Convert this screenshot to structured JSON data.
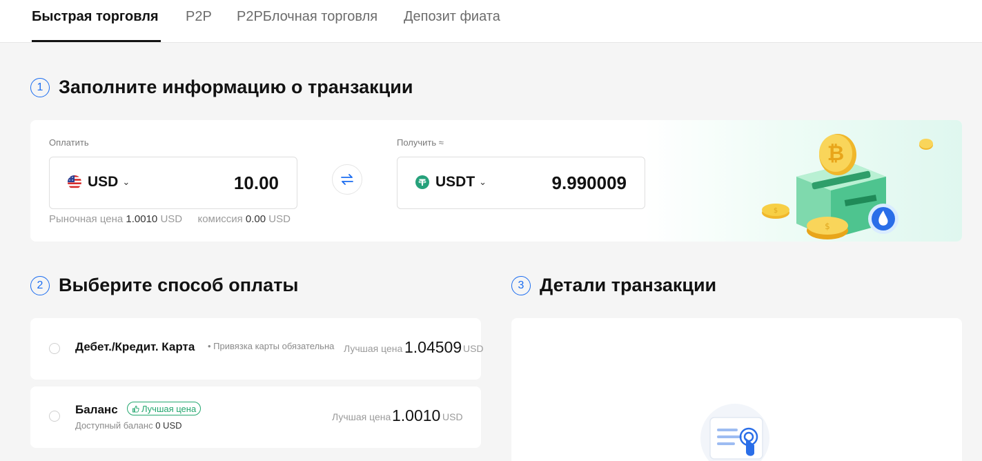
{
  "tabs": [
    "Быстрая торговля",
    "P2P",
    "P2PБлочная торговля",
    "Депозит фиата"
  ],
  "step1": {
    "num": "1",
    "title": "Заполните информацию о транзакции"
  },
  "pay": {
    "label": "Оплатить",
    "currency": "USD",
    "amount": "10.00",
    "flag_icon": "us-flag-icon"
  },
  "receive": {
    "label": "Получить ≈",
    "currency": "USDT",
    "amount": "9.990009",
    "token_icon": "tether-icon"
  },
  "rate": {
    "market_label": "Рыночная цена",
    "market_value": "1.0010",
    "market_unit": "USD",
    "fee_label": "комиссия",
    "fee_value": "0.00",
    "fee_unit": "USD"
  },
  "step2": {
    "num": "2",
    "title": "Выберите способ оплаты"
  },
  "step3": {
    "num": "3",
    "title": "Детали транзакции"
  },
  "methods": [
    {
      "name": "Дебет./Кредит. Карта",
      "note": "Привязка карты обязательна",
      "price_label": "Лучшая цена",
      "price": "1.04509",
      "unit": "USD"
    },
    {
      "name": "Баланс",
      "badge": "Лучшая цена",
      "available_label": "Доступный баланс",
      "available_value": "0 USD",
      "price_label": "Лучшая цена",
      "price": "1.0010",
      "unit": "USD"
    }
  ],
  "colors": {
    "accent": "#1a6cf0",
    "green": "#22a66d",
    "tether": "#26a17b"
  }
}
